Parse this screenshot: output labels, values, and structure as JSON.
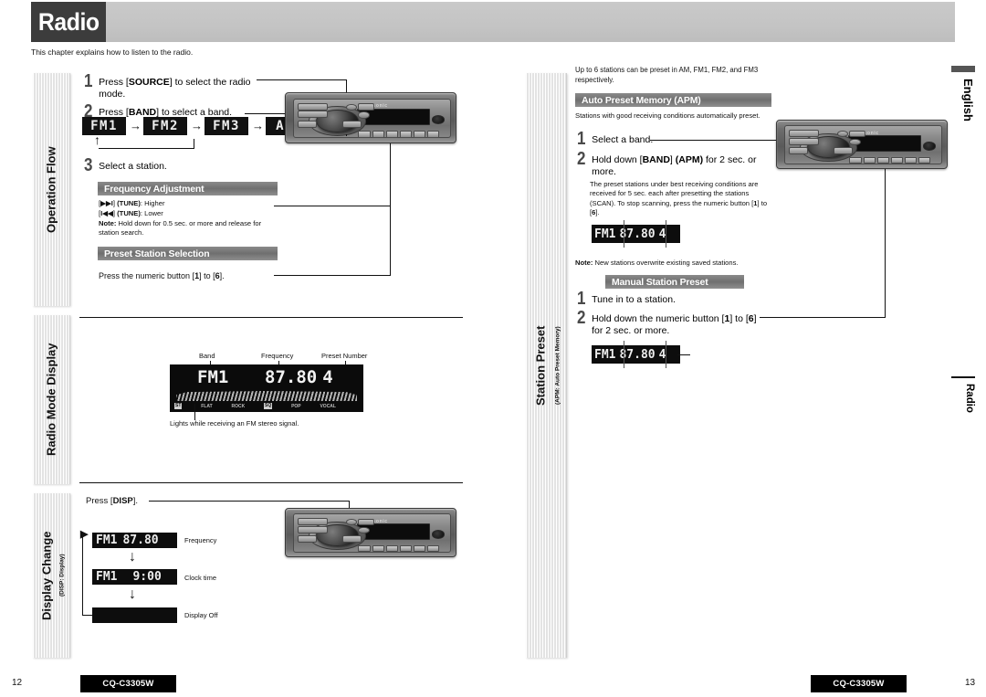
{
  "header": {
    "title": "Radio",
    "intro": "This chapter explains how to listen to the radio."
  },
  "edge_tabs": {
    "language": "English",
    "section": "Radio"
  },
  "left_page": {
    "sidebars": [
      {
        "label": "Operation Flow",
        "sub": ""
      },
      {
        "label": "Radio Mode Display",
        "sub": ""
      },
      {
        "label": "Display Change",
        "sub": "(DISP: Display)"
      }
    ],
    "operation_flow": {
      "steps": [
        {
          "num": "1",
          "text_html": "Press [<b>SOURCE</b>] to select the radio mode."
        },
        {
          "num": "2",
          "text_html": "Press [<b>BAND</b>] to select a band."
        },
        {
          "num": "3",
          "text_html": "Select a station."
        }
      ],
      "band_sequence": [
        "FM1",
        "FM2",
        "FM3",
        "AM"
      ],
      "band_arrow": "→",
      "loop_arrow": "↑",
      "frequency_adjustment": {
        "heading": "Frequency Adjustment",
        "line1_html": "[<b>▶▶I</b>] <b>(TUNE)</b>: Higher",
        "line2_html": "[<b>I◀◀</b>] <b>(TUNE)</b>: Lower",
        "note_html": "<b>Note:</b> Hold down for 0.5 sec. or more and release for station search."
      },
      "preset_station_selection": {
        "heading": "Preset Station Selection",
        "text_html": "Press the numeric button [<b>1</b>] to [<b>6</b>]."
      }
    },
    "radio_mode_display": {
      "callouts": [
        "Band",
        "Frequency",
        "Preset Number"
      ],
      "display": {
        "band": "FM1",
        "frequency": "87.80",
        "preset": "4",
        "indicators": [
          "ST",
          "FLAT",
          "ROCK",
          "SQ",
          "POP",
          "VOCAL"
        ]
      },
      "footnote": "Lights while receiving an FM stereo signal."
    },
    "display_change": {
      "instruction_html": "Press [<b>DISP</b>].",
      "flow": [
        {
          "lcd_band": "FM1",
          "lcd_value": "87.80",
          "label": "Frequency"
        },
        {
          "lcd_band": "FM1",
          "lcd_value": "9:00",
          "label": "Clock time"
        },
        {
          "lcd_band": "",
          "lcd_value": "",
          "label": "Display Off"
        }
      ],
      "down_arrow": "↓"
    }
  },
  "right_page": {
    "sidebar": {
      "label": "Station Preset",
      "sub": "(APM: Auto Preset Memory)"
    },
    "intro": "Up to 6 stations can be preset in AM, FM1, FM2, and FM3 respectively.",
    "auto_preset": {
      "heading": "Auto Preset Memory (APM)",
      "subtext": "Stations with good receiving conditions automatically preset.",
      "steps": [
        {
          "num": "1",
          "text_html": "Select a band."
        },
        {
          "num": "2",
          "text_html": "Hold down [<b>BAND</b>] <b>(APM)</b> for 2 sec. or more."
        }
      ],
      "detail_html": "The preset stations under best receiving conditions are received for 5 sec. each after presetting the stations (SCAN). To stop scanning, press the numeric button [<b>1</b>] to [<b>6</b>].",
      "display": {
        "band": "FM1",
        "frequency": "87.80",
        "preset": "4"
      },
      "note_html": "<b>Note:</b> New stations overwrite existing saved stations."
    },
    "manual_preset": {
      "heading": "Manual Station Preset",
      "steps": [
        {
          "num": "1",
          "text_html": "Tune in to a station."
        },
        {
          "num": "2",
          "text_html": "Hold down the numeric button [<b>1</b>] to [<b>6</b>] for 2 sec. or more."
        }
      ],
      "display": {
        "band": "FM1",
        "frequency": "87.80",
        "preset": "4"
      }
    }
  },
  "footer": {
    "left_page_number": "12",
    "right_page_number": "13",
    "model_left": "CQ-C3305W",
    "model_right": "CQ-C3305W"
  },
  "colors": {
    "header_band": "#c6c6c6",
    "title_box": "#3c3c3c",
    "subhead": "#7a7a7a",
    "lcd_bg": "#0b0b0b",
    "lcd_fg": "#efefef"
  }
}
